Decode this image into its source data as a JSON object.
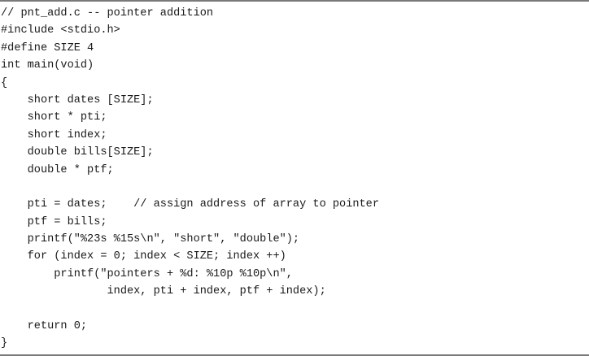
{
  "listing": {
    "lines": [
      "// pnt_add.c -- pointer addition",
      "#include <stdio.h>",
      "#define SIZE 4",
      "int main(void)",
      "{",
      "    short dates [SIZE];",
      "    short * pti;",
      "    short index;",
      "    double bills[SIZE];",
      "    double * ptf;",
      "",
      "    pti = dates;    // assign address of array to pointer",
      "    ptf = bills;",
      "    printf(\"%23s %15s\\n\", \"short\", \"double\");",
      "    for (index = 0; index < SIZE; index ++)",
      "        printf(\"pointers + %d: %10p %10p\\n\",",
      "                index, pti + index, ptf + index);",
      "",
      "    return 0;",
      "}"
    ]
  }
}
